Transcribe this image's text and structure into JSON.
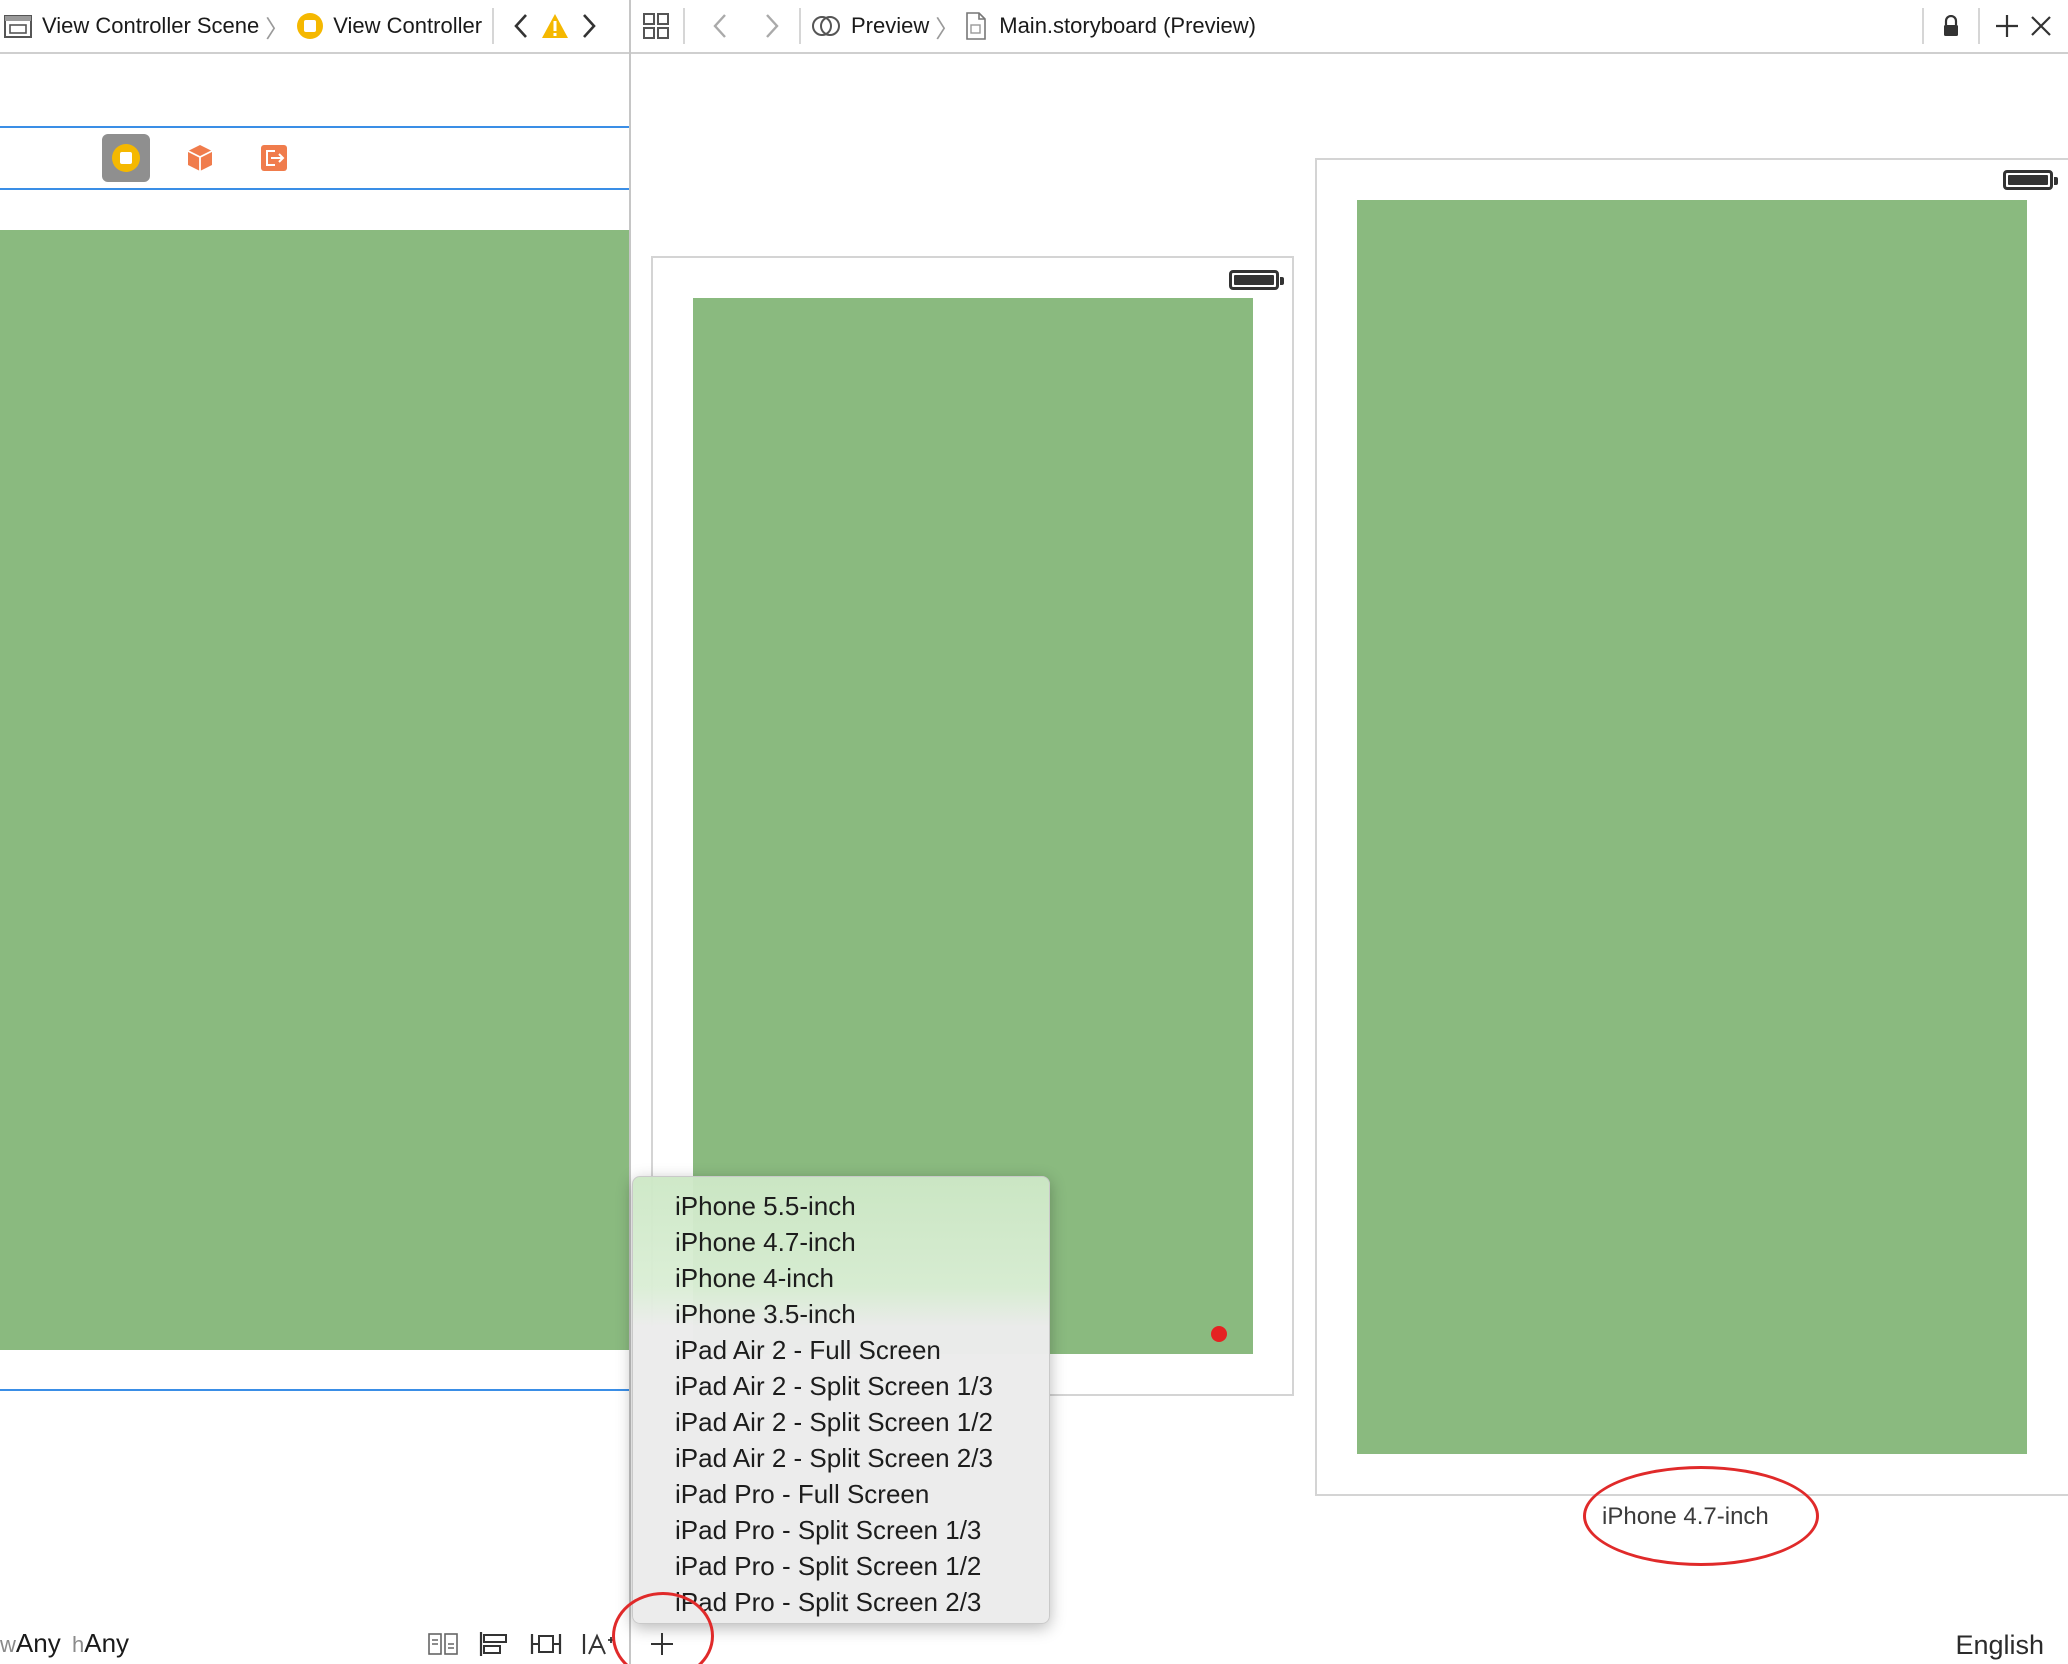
{
  "left_jumpbar": {
    "scene_label": "View Controller Scene",
    "controller_label": "View Controller"
  },
  "right_jumpbar": {
    "preview_label": "Preview",
    "file_label": "Main.storyboard (Preview)"
  },
  "preview": {
    "device_right_label": "iPhone 4.7-inch"
  },
  "device_menu": {
    "items": [
      "iPhone 5.5-inch",
      "iPhone 4.7-inch",
      "iPhone 4-inch",
      "iPhone 3.5-inch",
      "iPad Air 2 - Full Screen",
      "iPad Air 2 - Split Screen 1/3",
      "iPad Air 2 - Split Screen 1/2",
      "iPad Air 2 - Split Screen 2/3",
      "iPad Pro - Full Screen",
      "iPad Pro - Split Screen 1/3",
      "iPad Pro - Split Screen 1/2",
      "iPad Pro - Split Screen 2/3"
    ]
  },
  "bottom_bar": {
    "w_prefix": "w",
    "w_value": "Any",
    "h_prefix": "h",
    "h_value": "Any",
    "language": "English"
  },
  "colors": {
    "view_background": "#8aba7f",
    "selection_line": "#3a8ee6",
    "annotation": "#e02a2a",
    "warning": "#f5b800",
    "exit_orange": "#f07c4c"
  }
}
